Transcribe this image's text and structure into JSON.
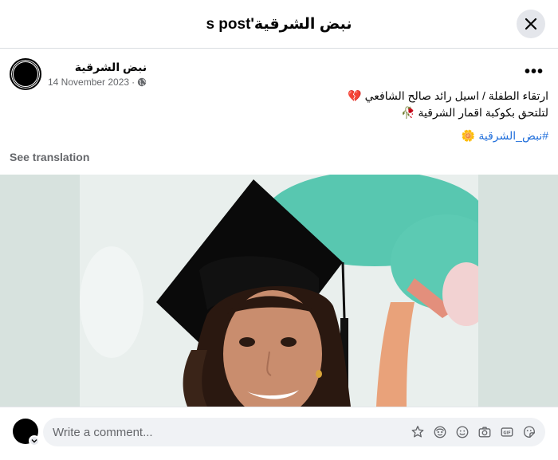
{
  "dialog": {
    "title": "نبض الشرقية's post"
  },
  "post": {
    "author": "نبض الشرقية",
    "date": "14 November 2023",
    "dot": "·",
    "privacy_icon": "globe-icon",
    "more_label": "•••",
    "text_line1": "ارتقاء الطفلة / اسيل رائد صالح الشافعي",
    "text_line1_emoji": "💔",
    "text_line2": "لتلتحق بكوكبة اقمار الشرقية",
    "text_line2_emoji": "🥀",
    "hashtag": "#نبض_الشرقية",
    "hashtag_emoji": "🌼",
    "see_translation": "See translation"
  },
  "composer": {
    "placeholder": "Write a comment...",
    "tools": [
      "sticker-icon",
      "avatar-sticker-icon",
      "emoji-icon",
      "camera-icon",
      "gif-icon",
      "smiley-sticker-icon"
    ]
  },
  "colors": {
    "hashtag": "#216fdb",
    "muted": "#65676b",
    "divider": "#dadde1",
    "close_bg": "#e4e6eb"
  }
}
